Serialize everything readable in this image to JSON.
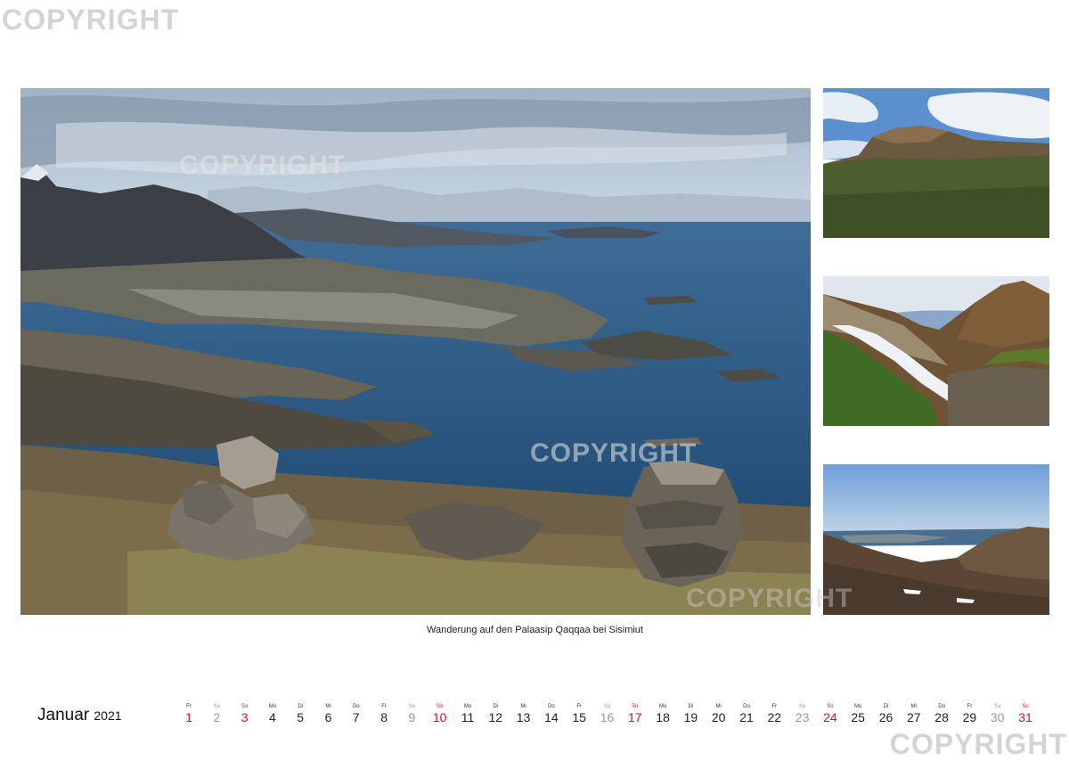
{
  "watermark": "COPYRIGHT",
  "caption": "Wanderung auf den Palaasip Qaqqaa bei Sisimiut",
  "calendar": {
    "month": "Januar",
    "year": "2021",
    "days": [
      {
        "dn": "Fr",
        "num": "1",
        "kind": "hol"
      },
      {
        "dn": "Sa",
        "num": "2",
        "kind": "sat"
      },
      {
        "dn": "So",
        "num": "3",
        "kind": "sun"
      },
      {
        "dn": "Mo",
        "num": "4",
        "kind": "wd"
      },
      {
        "dn": "Di",
        "num": "5",
        "kind": "wd"
      },
      {
        "dn": "Mi",
        "num": "6",
        "kind": "wd"
      },
      {
        "dn": "Do",
        "num": "7",
        "kind": "wd"
      },
      {
        "dn": "Fr",
        "num": "8",
        "kind": "wd"
      },
      {
        "dn": "Sa",
        "num": "9",
        "kind": "sat"
      },
      {
        "dn": "So",
        "num": "10",
        "kind": "sun"
      },
      {
        "dn": "Mo",
        "num": "11",
        "kind": "wd"
      },
      {
        "dn": "Di",
        "num": "12",
        "kind": "wd"
      },
      {
        "dn": "Mi",
        "num": "13",
        "kind": "wd"
      },
      {
        "dn": "Do",
        "num": "14",
        "kind": "wd"
      },
      {
        "dn": "Fr",
        "num": "15",
        "kind": "wd"
      },
      {
        "dn": "Sa",
        "num": "16",
        "kind": "sat"
      },
      {
        "dn": "So",
        "num": "17",
        "kind": "sun"
      },
      {
        "dn": "Mo",
        "num": "18",
        "kind": "wd"
      },
      {
        "dn": "Di",
        "num": "19",
        "kind": "wd"
      },
      {
        "dn": "Mi",
        "num": "20",
        "kind": "wd"
      },
      {
        "dn": "Do",
        "num": "21",
        "kind": "wd"
      },
      {
        "dn": "Fr",
        "num": "22",
        "kind": "wd"
      },
      {
        "dn": "Sa",
        "num": "23",
        "kind": "sat"
      },
      {
        "dn": "So",
        "num": "24",
        "kind": "sun"
      },
      {
        "dn": "Mo",
        "num": "25",
        "kind": "wd"
      },
      {
        "dn": "Di",
        "num": "26",
        "kind": "wd"
      },
      {
        "dn": "Mi",
        "num": "27",
        "kind": "wd"
      },
      {
        "dn": "Do",
        "num": "28",
        "kind": "wd"
      },
      {
        "dn": "Fr",
        "num": "29",
        "kind": "wd"
      },
      {
        "dn": "Sa",
        "num": "30",
        "kind": "sat"
      },
      {
        "dn": "So",
        "num": "31",
        "kind": "sun"
      }
    ]
  },
  "colors": {
    "sunday": "#c8102e",
    "saturday": "#9a9a9a",
    "weekday": "#222222",
    "watermark": "#d4d4d4"
  }
}
